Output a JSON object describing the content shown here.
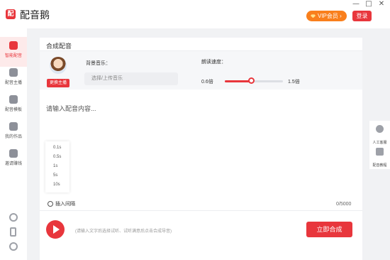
{
  "app": {
    "logo_char": "配",
    "title": "配音鹅",
    "vip_label": "VIP会员 ›",
    "login_label": "登录",
    "window_controls": [
      "—",
      "□",
      "✕"
    ]
  },
  "sidebar": {
    "items": [
      {
        "label": "智能配音",
        "icon": "microphone-icon",
        "active": true
      },
      {
        "label": "配音主播",
        "icon": "anchor-icon",
        "active": false
      },
      {
        "label": "配音模板",
        "icon": "template-icon",
        "active": false
      },
      {
        "label": "我的作品",
        "icon": "folder-icon",
        "active": false
      },
      {
        "label": "邀请赚钱",
        "icon": "money-bag-icon",
        "active": false
      }
    ],
    "bottom_icons": [
      "link-icon",
      "phone-icon",
      "settings-icon"
    ]
  },
  "main": {
    "card_title": "合成配音",
    "change_anchor_label": "更换主播",
    "bgm_label": "背景音乐：",
    "bgm_placeholder": "选择/上传音乐",
    "speed_label": "朗读速度：",
    "speed_min": "0.6倍",
    "speed_max": "1.5倍",
    "speed_fraction": 0.45,
    "text_placeholder": "请输入配音内容...",
    "pause_options": [
      "0.1s",
      "0.5s",
      "1s",
      "5s",
      "10s"
    ],
    "insert_pause_label": "插入间隔",
    "char_count": "0/5000",
    "hint": "(请输入文字后选择试听、试听满意后点击合成导音)",
    "synthesize_label": "立即合成"
  },
  "right_panel": {
    "items": [
      {
        "label": "人工客服",
        "icon": "customer-service-icon"
      },
      {
        "label": "配音教程",
        "icon": "tutorial-book-icon"
      }
    ]
  },
  "colors": {
    "accent": "#e8363c",
    "vip": "#f97f1c"
  }
}
